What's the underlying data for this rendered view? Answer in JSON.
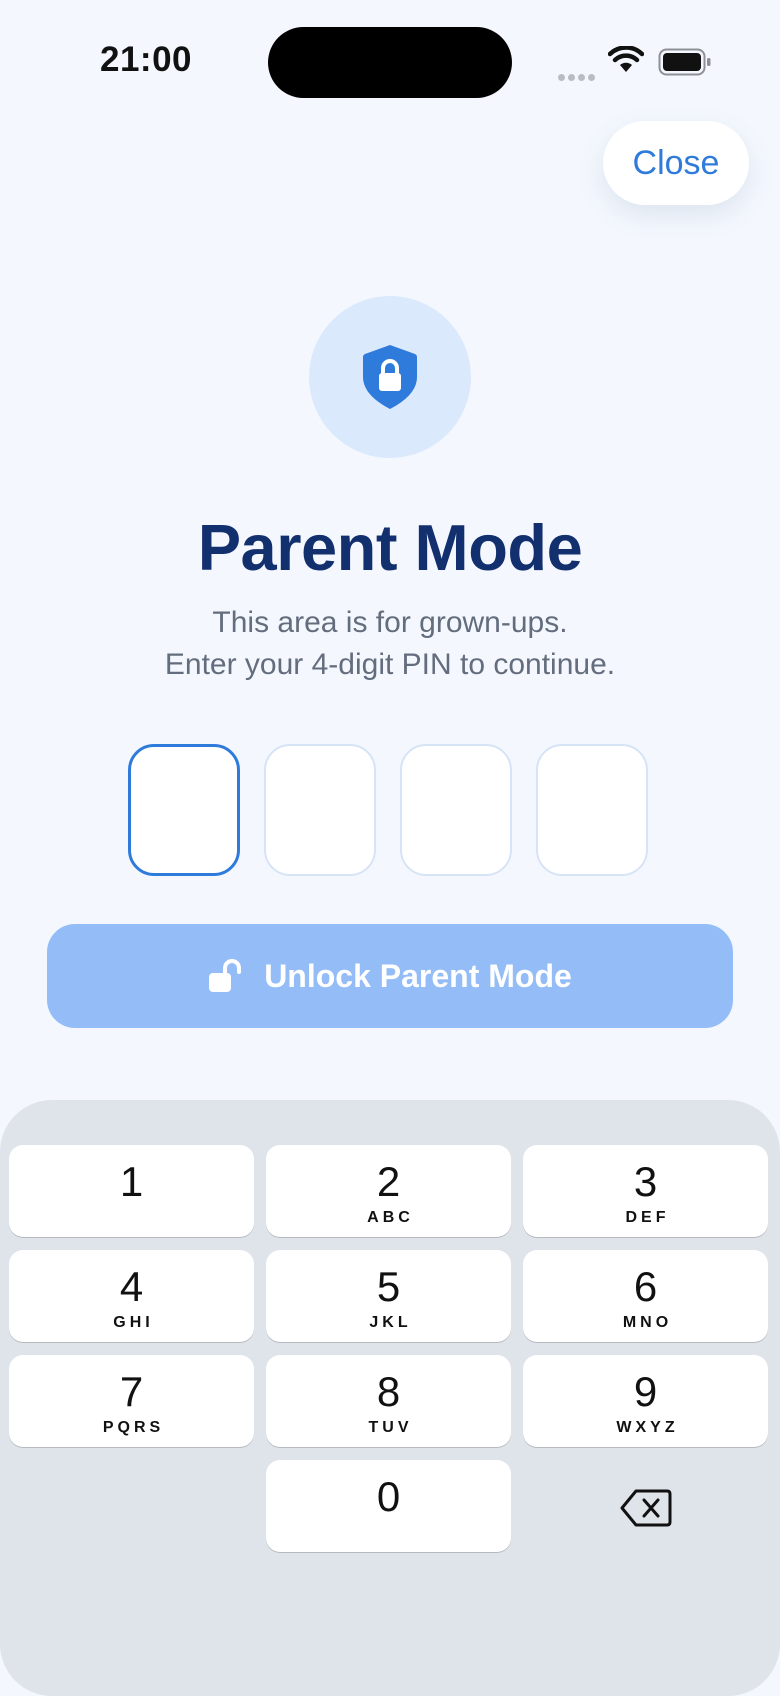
{
  "status_bar": {
    "time": "21:00"
  },
  "header": {
    "close_label": "Close"
  },
  "hero": {
    "icon": "shield-lock-icon",
    "title": "Parent Mode",
    "subtitle_line1": "This area is for grown-ups.",
    "subtitle_line2": "Enter your 4-digit PIN to continue."
  },
  "pin": {
    "length": 4,
    "entered": [
      "",
      "",
      "",
      ""
    ]
  },
  "unlock_button": {
    "label": "Unlock Parent Mode",
    "icon": "unlock-icon",
    "enabled": false
  },
  "keypad": {
    "keys": [
      {
        "digit": "1",
        "letters": ""
      },
      {
        "digit": "2",
        "letters": "ABC"
      },
      {
        "digit": "3",
        "letters": "DEF"
      },
      {
        "digit": "4",
        "letters": "GHI"
      },
      {
        "digit": "5",
        "letters": "JKL"
      },
      {
        "digit": "6",
        "letters": "MNO"
      },
      {
        "digit": "7",
        "letters": "PQRS"
      },
      {
        "digit": "8",
        "letters": "TUV"
      },
      {
        "digit": "9",
        "letters": "WXYZ"
      },
      {
        "digit": "0",
        "letters": ""
      }
    ],
    "backspace_icon": "backspace-icon"
  },
  "colors": {
    "accent": "#2f7bdc",
    "title": "#13306e",
    "button_disabled": "#94bdf8",
    "background": "#f4f8fe",
    "keypad_background": "#dfe3ea"
  }
}
